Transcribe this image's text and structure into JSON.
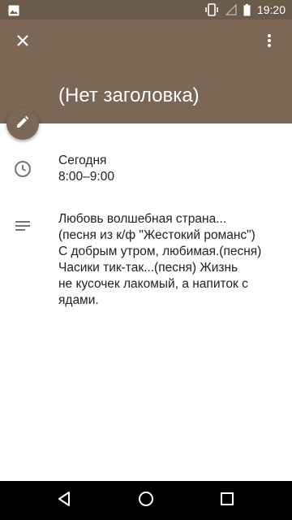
{
  "status_bar": {
    "time": "19:20",
    "left_icon": "image-notification-icon",
    "right_icons": [
      "vibrate-icon",
      "signal-icon",
      "battery-icon"
    ]
  },
  "header": {
    "title": "(Нет заголовка)",
    "close_icon": "close-icon",
    "more_icon": "more-vert-icon",
    "color": "#7a6755"
  },
  "edit_fab": {
    "icon": "edit-pencil-icon"
  },
  "event_time": {
    "icon": "clock-icon",
    "day": "Сегодня",
    "range": "8:00–9:00"
  },
  "description": {
    "icon": "notes-icon",
    "lines": [
      "Любовь волшебная страна...",
      "(песня из к/ф \"Жестокий романс\")",
      "С добрым утром, любимая.(песня)",
      "Часики тик-так...(песня) Жизнь",
      "не кусочек лакомый, а напиток с",
      "ядами."
    ]
  },
  "nav_bar": {
    "back_icon": "back-icon",
    "home_icon": "home-icon",
    "recents_icon": "recents-icon"
  }
}
